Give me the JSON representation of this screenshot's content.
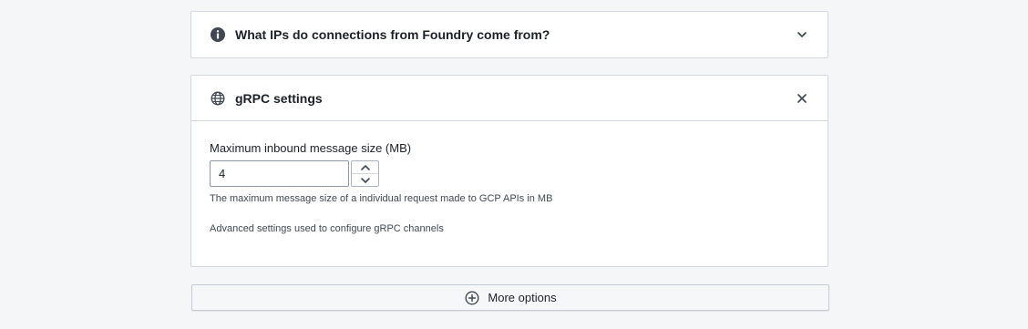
{
  "faq": {
    "title": "What IPs do connections from Foundry come from?",
    "icon": "info-icon",
    "toggle_icon": "chevron-down-icon"
  },
  "grpc": {
    "title": "gRPC settings",
    "icon": "globe-icon",
    "close_icon": "close-icon",
    "field_label": "Maximum inbound message size (MB)",
    "field_value": "4",
    "help_text": "The maximum message size of a individual request made to GCP APIs in MB",
    "advanced_text": "Advanced settings used to configure gRPC channels"
  },
  "more_options": {
    "label": "More options",
    "icon": "add-circle-icon"
  }
}
